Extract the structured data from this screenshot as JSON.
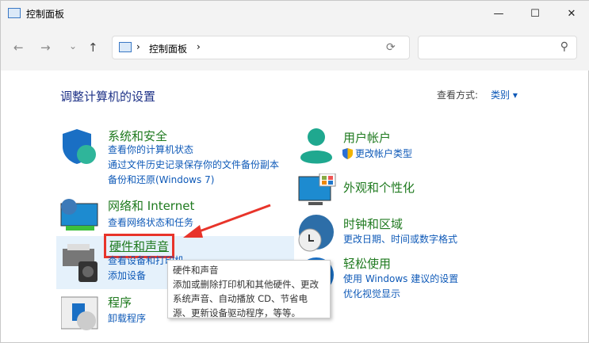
{
  "window": {
    "title": "控制面板",
    "minimize": "—",
    "maximize": "☐",
    "close": "✕"
  },
  "address": {
    "path": [
      "控制面板"
    ],
    "sep": "›",
    "refresh": "⟳",
    "search_icon": "⚲"
  },
  "nav": {
    "back": "←",
    "forward": "→",
    "dropdown": "⌄",
    "up": "↑"
  },
  "main": {
    "heading": "调整计算机的设置",
    "view_label": "查看方式:",
    "view_value": "类别 ▾"
  },
  "categories": [
    {
      "title": "系统和安全",
      "links": [
        "查看你的计算机状态",
        "通过文件历史记录保存你的文件备份副本",
        "备份和还原(Windows 7)"
      ],
      "icon": "shield-icon"
    },
    {
      "title": "网络和 Internet",
      "links": [
        "查看网络状态和任务"
      ],
      "icon": "network-icon"
    },
    {
      "title": "硬件和声音",
      "links": [
        "查看设备和打印机",
        "添加设备"
      ],
      "icon": "printer-icon"
    },
    {
      "title": "程序",
      "links": [
        "卸载程序"
      ],
      "icon": "programs-icon"
    },
    {
      "title": "用户帐户",
      "links": [
        "更改帐户类型"
      ],
      "icon": "user-icon"
    },
    {
      "title": "外观和个性化",
      "links": [],
      "icon": "monitor-icon"
    },
    {
      "title": "时钟和区域",
      "links": [
        "更改日期、时间或数字格式"
      ],
      "icon": "clock-globe-icon"
    },
    {
      "title": "轻松使用",
      "links": [
        "使用 Windows 建议的设置",
        "优化视觉显示"
      ],
      "icon": "accessibility-icon"
    }
  ],
  "tooltip": {
    "title": "硬件和声音",
    "body": "添加或删除打印机和其他硬件、更改系统声音、自动播放 CD、节省电源、更新设备驱动程序，等等。"
  },
  "colors": {
    "category": "#1f7a1f",
    "link": "#0f5ab8",
    "annotation": "#e8342a"
  }
}
